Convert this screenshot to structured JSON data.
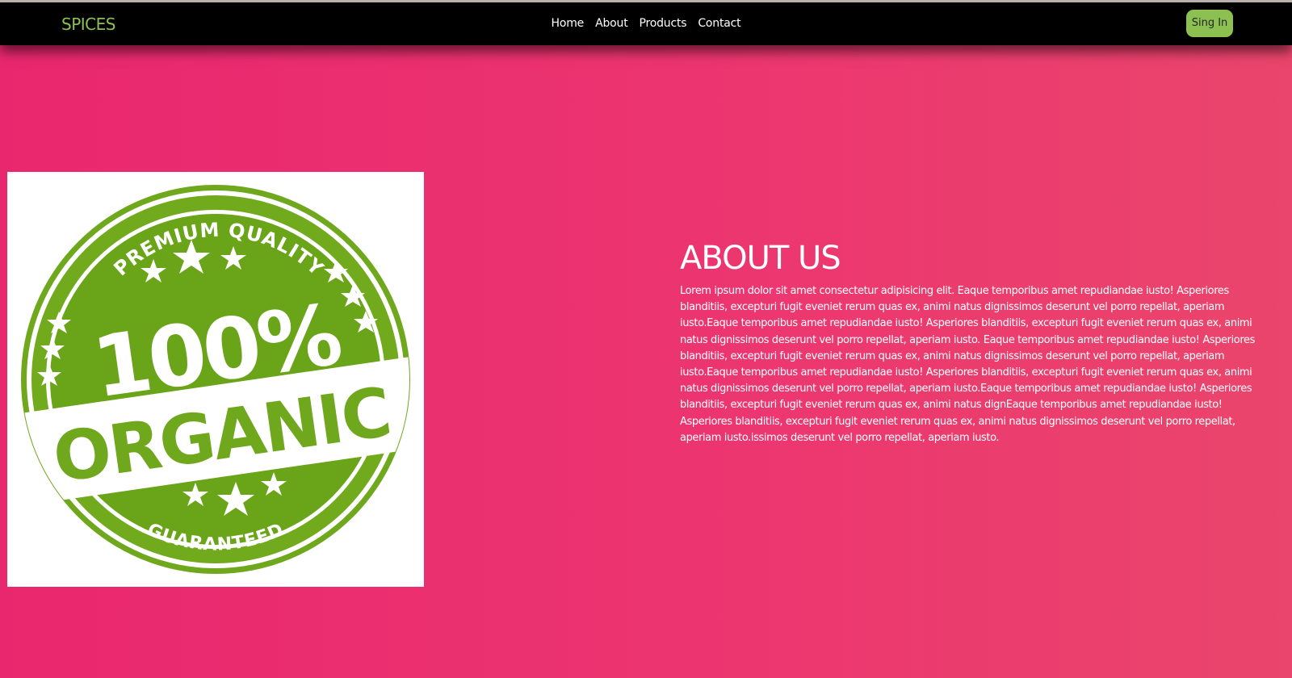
{
  "header": {
    "brand": "SPICES",
    "nav": [
      "Home",
      "About",
      "Products",
      "Contact"
    ],
    "signin_label": "Sing In"
  },
  "badge": {
    "arc_top": "PREMIUM QUALITY",
    "big_number": "100%",
    "ribbon": "ORGANIC",
    "arc_bottom": "GUARANTEED"
  },
  "about": {
    "title": "ABOUT US",
    "body": "Lorem ipsum dolor sit amet consectetur adipisicing elit. Eaque temporibus amet repudiandae iusto! Asperiores blanditiis, excepturi fugit eveniet rerum quas ex, animi natus dignissimos deserunt vel porro repellat, aperiam iusto.Eaque temporibus amet repudiandae iusto! Asperiores blanditiis, excepturi fugit eveniet rerum quas ex, animi natus dignissimos deserunt vel porro repellat, aperiam iusto. Eaque temporibus amet repudiandae iusto! Asperiores blanditiis, excepturi fugit eveniet rerum quas ex, animi natus dignissimos deserunt vel porro repellat, aperiam iusto.Eaque temporibus amet repudiandae iusto! Asperiores blanditiis, excepturi fugit eveniet rerum quas ex, animi natus dignissimos deserunt vel porro repellat, aperiam iusto.Eaque temporibus amet repudiandae iusto! Asperiores blanditiis, excepturi fugit eveniet rerum quas ex, animi natus dignEaque temporibus amet repudiandae iusto! Asperiores blanditiis, excepturi fugit eveniet rerum quas ex, animi natus dignissimos deserunt vel porro repellat, aperiam iusto.issimos deserunt vel porro repellat, aperiam iusto."
  },
  "colors": {
    "accent_green": "#8cc152",
    "badge_green": "#6fa81d",
    "background_pink": "#e9276e",
    "header_black": "#000000"
  }
}
